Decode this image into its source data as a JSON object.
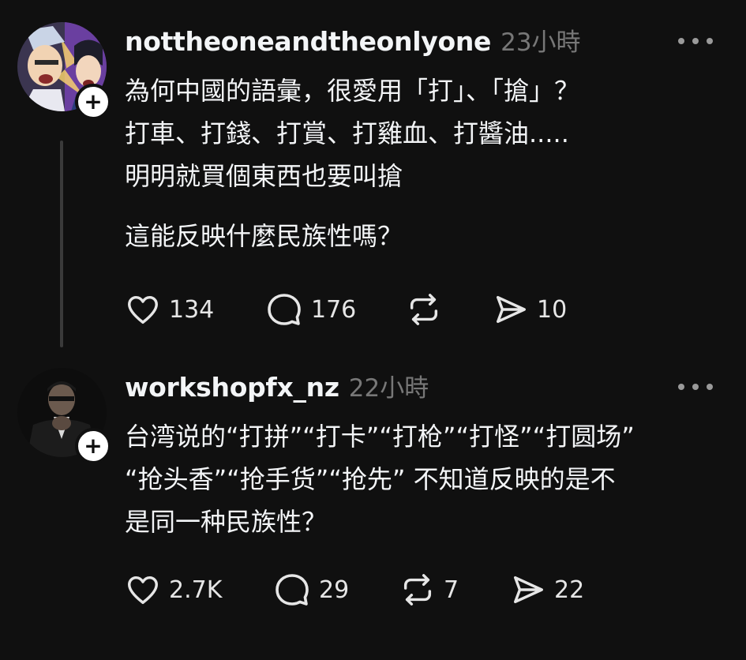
{
  "posts": [
    {
      "username": "nottheoneandtheonlyone",
      "time": "23小時",
      "body_lines": [
        "為何中國的語彙，很愛用「打」、「搶」？",
        "打車、打錢、打賞、打雞血、打醬油.....",
        "明明就買個東西也要叫搶"
      ],
      "body_lines_2": [
        "這能反映什麼民族性嗎？"
      ],
      "likes": "134",
      "comments": "176",
      "reposts": "",
      "shares": "10"
    },
    {
      "username": "workshopfx_nz",
      "time": "22小時",
      "body_lines": [
        "台湾说的“打拼”“打卡”“打枪”“打怪”“打圆场”",
        "“抢头香”“抢手货”“抢先” 不知道反映的是不",
        "是同一种民族性？"
      ],
      "likes": "2.7K",
      "comments": "29",
      "reposts": "7",
      "shares": "22"
    }
  ],
  "follow_symbol": "+",
  "icons": {
    "like": "heart-icon",
    "comment": "speech-bubble-icon",
    "repost": "repost-arrows-icon",
    "share": "send-paper-plane-icon",
    "more": "more-dots-icon"
  },
  "colors": {
    "background": "#101010",
    "text": "#f3f5f7",
    "muted": "#777777",
    "thread_line": "#3a3a3a"
  }
}
